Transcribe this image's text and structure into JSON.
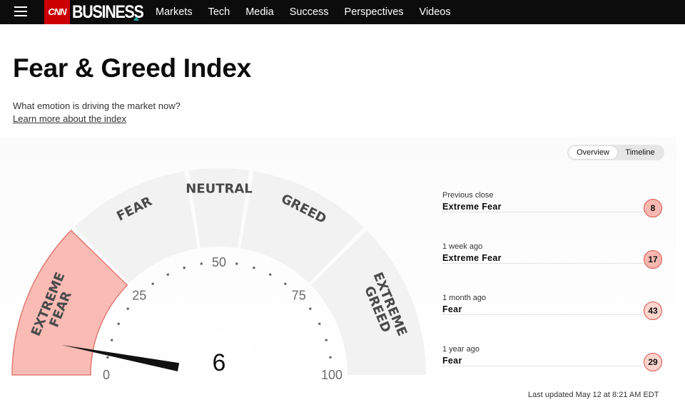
{
  "nav": {
    "logo_cnn": "CNN",
    "logo_business": "BUSINESS",
    "items": [
      {
        "label": "Markets"
      },
      {
        "label": "Tech"
      },
      {
        "label": "Media"
      },
      {
        "label": "Success"
      },
      {
        "label": "Perspectives"
      },
      {
        "label": "Videos"
      }
    ]
  },
  "page": {
    "title": "Fear & Greed Index",
    "subtitle": "What emotion is driving the market now?",
    "learn_more": "Learn more about the index"
  },
  "view_toggle": {
    "options": [
      "Overview",
      "Timeline"
    ],
    "selected": "Overview"
  },
  "gauge": {
    "value": 6,
    "value_text": "6",
    "min": 0,
    "max": 100,
    "ticks": [
      "0",
      "25",
      "50",
      "75",
      "100"
    ],
    "segments": [
      {
        "line1": "EXTREME",
        "line2": "FEAR",
        "from": 0,
        "to": 25,
        "active": true
      },
      {
        "line1": "FEAR",
        "line2": "",
        "from": 25,
        "to": 45,
        "active": false
      },
      {
        "line1": "NEUTRAL",
        "line2": "",
        "from": 45,
        "to": 55,
        "active": false
      },
      {
        "line1": "GREED",
        "line2": "",
        "from": 55,
        "to": 75,
        "active": false
      },
      {
        "line1": "EXTREME",
        "line2": "GREED",
        "from": 75,
        "to": 100,
        "active": false
      }
    ],
    "colors": {
      "active_fill": "#fabbb5",
      "active_stroke": "#e07a72",
      "inactive_fill": "#f2f2f2",
      "needle": "#111111",
      "label": "#4a4a4a"
    }
  },
  "history": [
    {
      "label": "Previous close",
      "rating": "Extreme Fear",
      "value": "8",
      "level": "extreme-fear"
    },
    {
      "label": "1 week ago",
      "rating": "Extreme Fear",
      "value": "17",
      "level": "extreme-fear"
    },
    {
      "label": "1 month ago",
      "rating": "Fear",
      "value": "43",
      "level": "fear"
    },
    {
      "label": "1 year ago",
      "rating": "Fear",
      "value": "29",
      "level": "fear"
    }
  ],
  "footer": {
    "last_updated": "Last updated May 12 at 8:21 AM EDT"
  }
}
